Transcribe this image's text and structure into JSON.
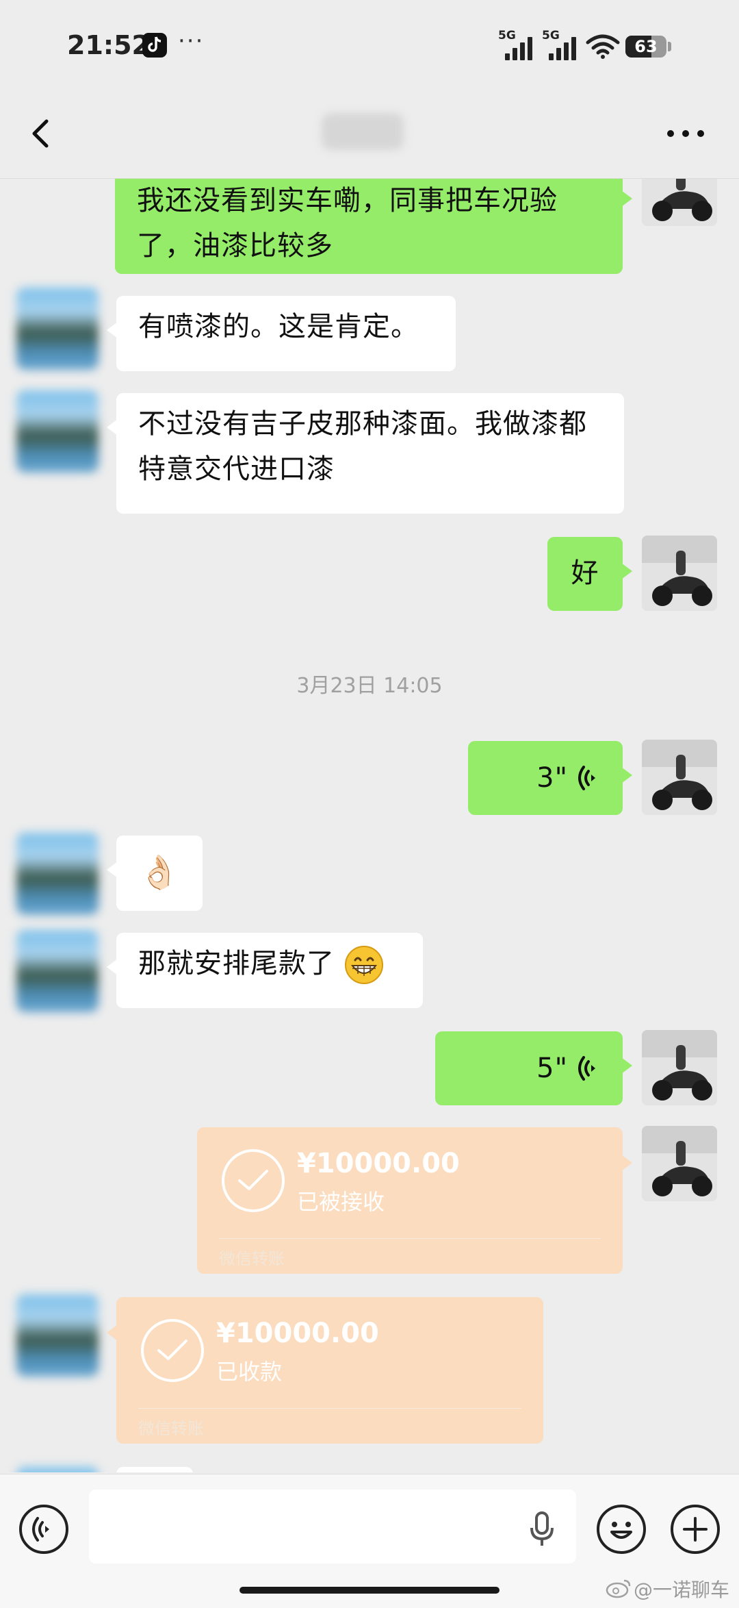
{
  "status_bar": {
    "time": "21:52",
    "overflow": "···",
    "signal1_label": "5G",
    "signal2_label": "5G",
    "battery": "63",
    "battery_level": 0.63
  },
  "navbar": {
    "back_icon": "chevron-left-icon",
    "contact_name": "师傅",
    "more_icon": "more-dots-icon"
  },
  "messages": [
    {
      "from": "me",
      "text": "我还没看到实车嘞，同事把车况验了，油漆比较多"
    },
    {
      "from": "them",
      "text": "有喷漆的。这是肯定。"
    },
    {
      "from": "them",
      "text": "不过没有吉子皮那种漆面。我做漆都特意交代进口漆"
    },
    {
      "from": "me",
      "text": "好"
    },
    {
      "timestamp": "3月23日 14:05"
    },
    {
      "from": "me",
      "voice_duration": "3\""
    },
    {
      "from": "them",
      "emoji": "👌🏻"
    },
    {
      "from": "them",
      "text": "那就安排尾款了"
    },
    {
      "from": "me",
      "voice_duration": "5\""
    },
    {
      "from": "me",
      "transfer": {
        "amount": "¥10000.00",
        "status": "已被接收",
        "label": "微信转账"
      }
    },
    {
      "from": "them",
      "transfer": {
        "amount": "¥10000.00",
        "status": "已收款",
        "label": "微信转账"
      }
    }
  ],
  "input_bar": {
    "voice_toggle_icon": "voice-mode-icon",
    "placeholder": "",
    "mic_icon": "microphone-icon",
    "emoji_icon": "smiley-icon",
    "plus_icon": "plus-icon"
  },
  "watermark": "@一诺聊车",
  "colors": {
    "background": "#ededed",
    "my_bubble": "#95ec69",
    "their_bubble": "#ffffff",
    "transfer": "#fbdcbe"
  }
}
